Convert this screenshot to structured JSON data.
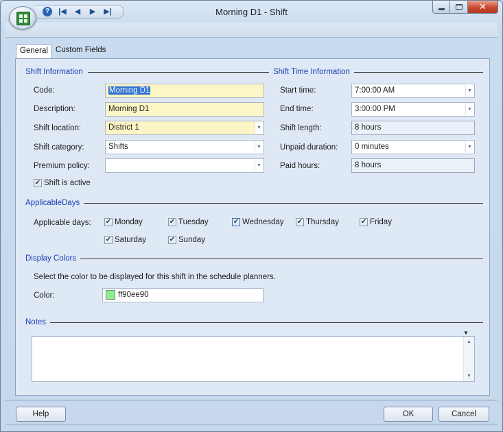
{
  "window": {
    "title": "Morning D1 - Shift"
  },
  "quick_access": {
    "icons": [
      "help-icon",
      "first-record-icon",
      "previous-record-icon",
      "next-record-icon",
      "last-record-icon"
    ]
  },
  "tabs": [
    {
      "label": "General",
      "active": true
    },
    {
      "label": "Custom Fields",
      "active": false
    }
  ],
  "shift_information": {
    "title": "Shift Information",
    "code": {
      "label": "Code:",
      "value": "Morning D1"
    },
    "description": {
      "label": "Description:",
      "value": "Morning D1"
    },
    "location": {
      "label": "Shift location:",
      "value": "District 1"
    },
    "category": {
      "label": "Shift category:",
      "value": "Shifts"
    },
    "premium": {
      "label": "Premium policy:",
      "value": ""
    },
    "active": {
      "label": "Shift is active",
      "checked": true
    }
  },
  "shift_time_information": {
    "title": "Shift Time Information",
    "start": {
      "label": "Start time:",
      "value": "7:00:00 AM"
    },
    "end": {
      "label": "End time:",
      "value": "3:00:00 PM"
    },
    "length": {
      "label": "Shift length:",
      "value": "8 hours"
    },
    "unpaid": {
      "label": "Unpaid duration:",
      "value": "0 minutes"
    },
    "paid": {
      "label": "Paid hours:",
      "value": "8 hours"
    }
  },
  "applicable_days": {
    "title": "ApplicableDays",
    "label": "Applicable days:",
    "days": [
      {
        "name": "Monday",
        "checked": true
      },
      {
        "name": "Tuesday",
        "checked": true
      },
      {
        "name": "Wednesday",
        "checked": true
      },
      {
        "name": "Thursday",
        "checked": true
      },
      {
        "name": "Friday",
        "checked": true
      },
      {
        "name": "Saturday",
        "checked": true
      },
      {
        "name": "Sunday",
        "checked": true
      }
    ]
  },
  "display_colors": {
    "title": "Display Colors",
    "instruction": "Select the color to be displayed for this shift in the schedule planners.",
    "color_label": "Color:",
    "color_value": "ff90ee90",
    "swatch_hex": "#90ee90"
  },
  "notes": {
    "title": "Notes",
    "value": ""
  },
  "buttons": {
    "help": "Help",
    "ok": "OK",
    "cancel": "Cancel"
  }
}
